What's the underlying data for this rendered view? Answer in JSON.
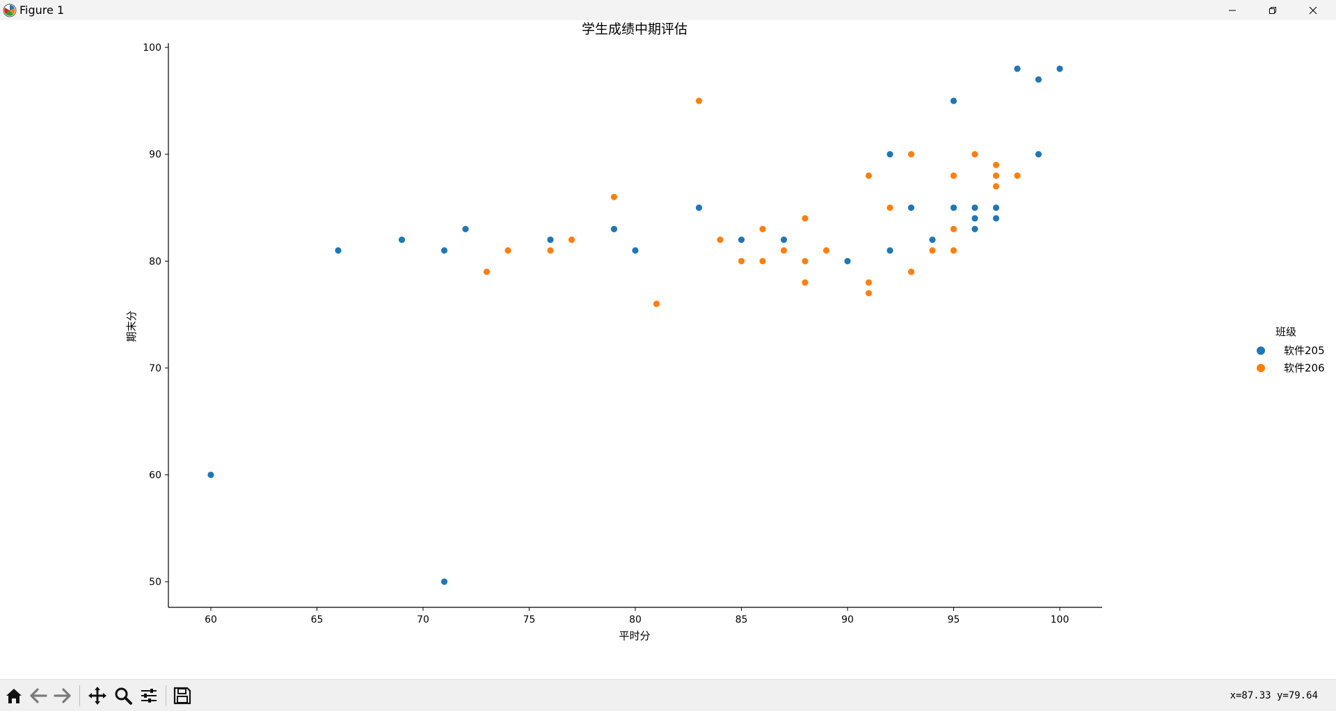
{
  "window": {
    "title": "Figure 1"
  },
  "toolbar": {
    "buttons": [
      "home-icon",
      "back-icon",
      "forward-icon",
      "pan-icon",
      "zoom-icon",
      "configure-icon",
      "save-icon"
    ],
    "coords": "x=87.33 y=79.64"
  },
  "colors": {
    "series_1": "#1f77b4",
    "series_2": "#ff7f0e"
  },
  "chart_data": {
    "type": "scatter",
    "title": "学生成绩中期评估",
    "xlabel": "平时分",
    "ylabel": "期末分",
    "xlim": [
      58,
      102
    ],
    "ylim": [
      47.6,
      100.4
    ],
    "xticks": [
      60,
      65,
      70,
      75,
      80,
      85,
      90,
      95,
      100
    ],
    "yticks": [
      50,
      60,
      70,
      80,
      90,
      100
    ],
    "grid": false,
    "legend": {
      "title": "班级",
      "placement": "right"
    },
    "series": [
      {
        "name": "软件205",
        "color": "#1f77b4",
        "points": [
          [
            60,
            60
          ],
          [
            66,
            81
          ],
          [
            69,
            82
          ],
          [
            71,
            81
          ],
          [
            71,
            50
          ],
          [
            72,
            83
          ],
          [
            76,
            82
          ],
          [
            79,
            83
          ],
          [
            80,
            81
          ],
          [
            83,
            85
          ],
          [
            85,
            82
          ],
          [
            87,
            82
          ],
          [
            90,
            80
          ],
          [
            92,
            90
          ],
          [
            92,
            81
          ],
          [
            93,
            85
          ],
          [
            94,
            82
          ],
          [
            95,
            95
          ],
          [
            95,
            85
          ],
          [
            96,
            85
          ],
          [
            96,
            84
          ],
          [
            96,
            83
          ],
          [
            97,
            85
          ],
          [
            97,
            84
          ],
          [
            98,
            98
          ],
          [
            99,
            97
          ],
          [
            99,
            90
          ],
          [
            100,
            98
          ]
        ]
      },
      {
        "name": "软件206",
        "color": "#ff7f0e",
        "points": [
          [
            73,
            79
          ],
          [
            74,
            81
          ],
          [
            76,
            81
          ],
          [
            77,
            82
          ],
          [
            79,
            86
          ],
          [
            81,
            76
          ],
          [
            83,
            95
          ],
          [
            84,
            82
          ],
          [
            85,
            80
          ],
          [
            86,
            83
          ],
          [
            86,
            80
          ],
          [
            87,
            81
          ],
          [
            88,
            84
          ],
          [
            88,
            80
          ],
          [
            88,
            78
          ],
          [
            89,
            81
          ],
          [
            91,
            88
          ],
          [
            91,
            78
          ],
          [
            91,
            77
          ],
          [
            92,
            85
          ],
          [
            93,
            90
          ],
          [
            93,
            79
          ],
          [
            94,
            81
          ],
          [
            95,
            88
          ],
          [
            95,
            83
          ],
          [
            95,
            81
          ],
          [
            96,
            90
          ],
          [
            97,
            89
          ],
          [
            97,
            88
          ],
          [
            97,
            87
          ],
          [
            98,
            88
          ]
        ]
      }
    ]
  }
}
